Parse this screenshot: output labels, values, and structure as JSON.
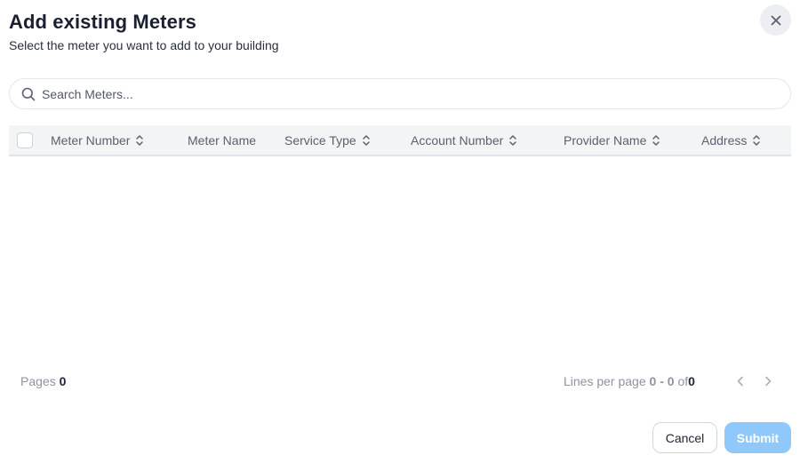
{
  "dialog": {
    "title": "Add existing Meters",
    "subtitle": "Select the meter you want to add to your building"
  },
  "search": {
    "placeholder": "Search Meters...",
    "value": ""
  },
  "table": {
    "columns": [
      {
        "label": "Meter Number",
        "sortable": true
      },
      {
        "label": "Meter Name",
        "sortable": false
      },
      {
        "label": "Service Type",
        "sortable": true
      },
      {
        "label": "Account Number",
        "sortable": true
      },
      {
        "label": "Provider Name",
        "sortable": true
      },
      {
        "label": "Address",
        "sortable": true
      }
    ],
    "rows": []
  },
  "pagination": {
    "pages_label": "Pages",
    "pages_value": "0",
    "lines_label": "Lines per page",
    "range": "0 - 0",
    "of_label": "of",
    "total": "0"
  },
  "actions": {
    "cancel_label": "Cancel",
    "submit_label": "Submit"
  },
  "colors": {
    "accent": "#8fc8fb",
    "header_bg": "#f3f4f6"
  },
  "icons": {
    "close": "close-icon",
    "search": "search-icon",
    "sort": "sort-icon",
    "prev": "chevron-left-icon",
    "next": "chevron-right-icon"
  }
}
